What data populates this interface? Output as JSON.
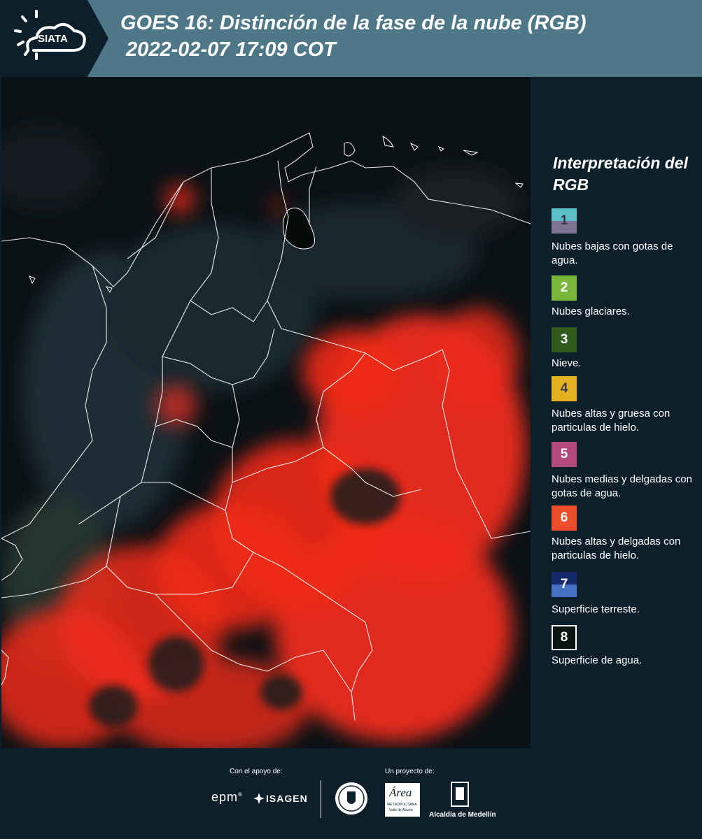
{
  "header": {
    "logo_text": "SIATA",
    "title_line1": "GOES 16: Distinción de la fase de la nube (RGB)",
    "title_line2": " 2022-02-07 17:09 COT"
  },
  "legend": {
    "title": "Interpretación del RGB",
    "items": [
      {
        "number": "1",
        "label": "Nubes bajas con gotas de agua.",
        "color_top": "#5bbfca",
        "color_bottom": "#7d7393"
      },
      {
        "number": "2",
        "label": "Nubes glaciares.",
        "color_top": "#7ab63a",
        "color_bottom": "#7ab63a"
      },
      {
        "number": "3",
        "label": "Nieve.",
        "color_top": "#2f5c1c",
        "color_bottom": "#2f5c1c"
      },
      {
        "number": "4",
        "label": "Nubes altas y gruesa con particulas de hielo.",
        "color_top": "#e3b21e",
        "color_bottom": "#e3b21e"
      },
      {
        "number": "5",
        "label": "Nubes medias y delgadas con gotas de agua.",
        "color_top": "#b2487e",
        "color_bottom": "#b2487e"
      },
      {
        "number": "6",
        "label": "Nubes altas y delgadas con particulas de hielo.",
        "color_top": "#ec4e2c",
        "color_bottom": "#ec4e2c"
      },
      {
        "number": "7",
        "label": "Superficie terreste.",
        "color_top": "#15286c",
        "color_bottom": "#4672c4"
      },
      {
        "number": "8",
        "label": "Superficie de agua.",
        "color_top": "#0a1410",
        "color_bottom": "#0a1410"
      }
    ]
  },
  "footer": {
    "support_label": "Con el apoyo de:",
    "project_label": "Un proyecto de:",
    "epm": "epm",
    "isagen": "ISAGEN",
    "area_name": "Área",
    "area_sub1": "METROPOLITANA",
    "area_sub2": "Valle de Aburrá",
    "alcaldia": "Alcaldía de Medellín"
  }
}
